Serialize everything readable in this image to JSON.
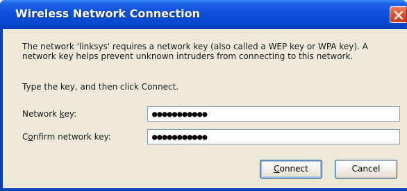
{
  "window": {
    "title": "Wireless Network Connection"
  },
  "message": {
    "line1": "The network 'linksys' requires a network key (also called a WEP key or WPA key). A",
    "line2": "network key helps prevent unknown intruders from connecting to this network."
  },
  "instruction": "Type the key, and then click Connect.",
  "fields": {
    "network_key": {
      "label_prefix": "Network ",
      "label_accel": "k",
      "label_suffix": "ey:",
      "value": "●●●●●●●●●●●"
    },
    "confirm_key": {
      "label_prefix": "C",
      "label_accel": "o",
      "label_suffix": "nfirm network key:",
      "value": "●●●●●●●●●●●"
    }
  },
  "buttons": {
    "connect": {
      "accel": "C",
      "rest": "onnect"
    },
    "cancel": "Cancel"
  },
  "colors": {
    "titlebar": "#0748cf",
    "dialog_face": "#ece9d8",
    "close_button": "#e0502a"
  }
}
